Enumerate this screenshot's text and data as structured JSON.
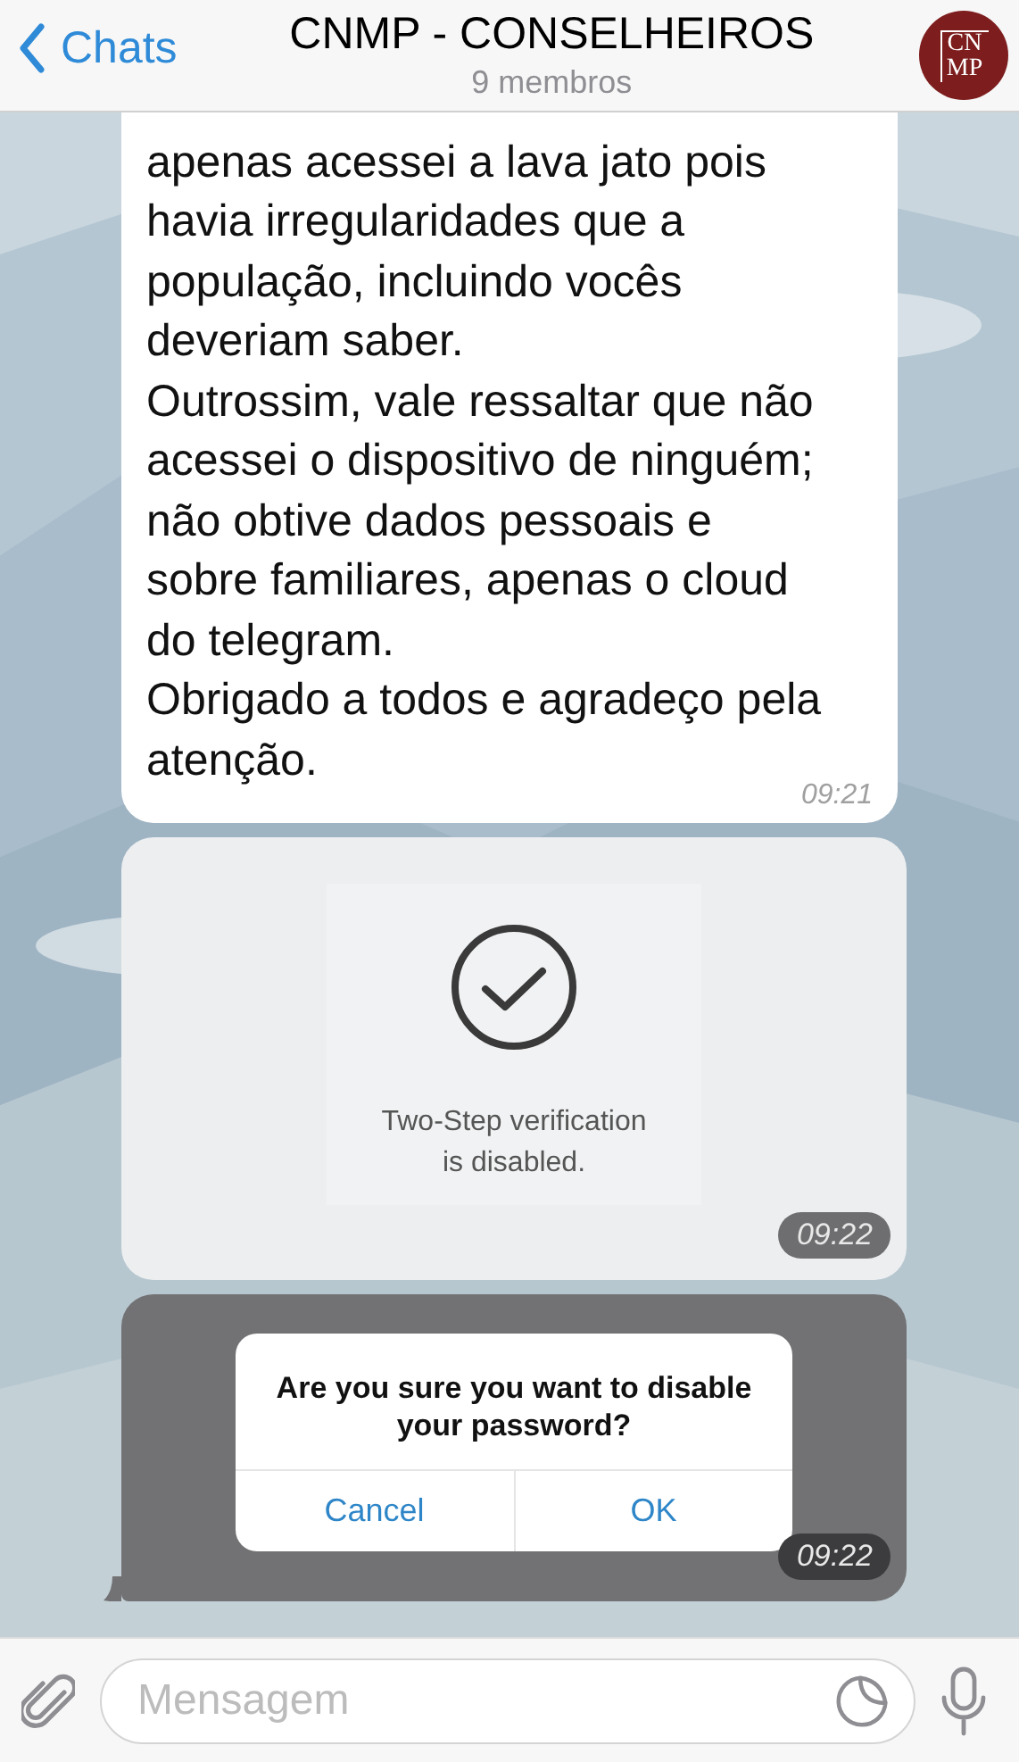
{
  "header": {
    "back_label": "Chats",
    "title": "CNMP - CONSELHEIROS",
    "subtitle": "9 membros",
    "avatar_text": "CN MP"
  },
  "messages": [
    {
      "kind": "text",
      "paragraphs": [
        "apenas acessei a lava jato pois\nhavia irregularidades que a\npopulação, incluindo vocês\ndeveriam saber.",
        "Outrossim, vale ressaltar que não\nacessei o dispositivo de ninguém;\nnão obtive dados pessoais e\nsobre familiares, apenas o cloud\ndo telegram.",
        "Obrigado a todos e agradeço pela\natenção."
      ],
      "time": "09:21"
    },
    {
      "kind": "status_image",
      "text": "Two-Step verification\nis disabled.",
      "time": "09:22"
    },
    {
      "kind": "dialog_image",
      "text": "Are you sure you want to disable\nyour password?",
      "buttons": [
        "Cancel",
        "OK"
      ],
      "time": "09:22"
    }
  ],
  "composer": {
    "placeholder": "Mensagem"
  }
}
